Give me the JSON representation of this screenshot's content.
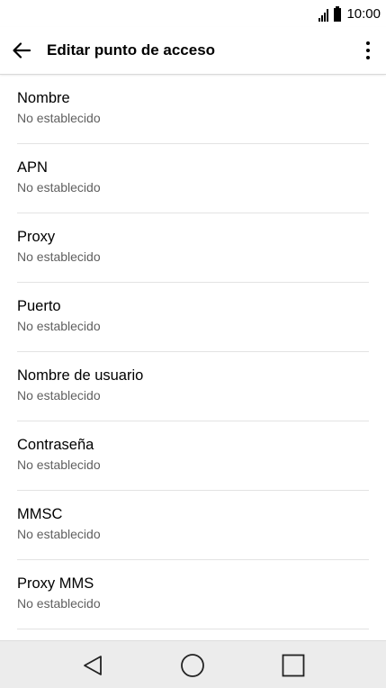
{
  "status_bar": {
    "time": "10:00",
    "icons": [
      "signal-icon",
      "battery-icon"
    ]
  },
  "app_bar": {
    "title": "Editar punto de acceso",
    "icons": [
      "back-arrow-icon",
      "more-vert-icon"
    ]
  },
  "settings": [
    {
      "label": "Nombre",
      "value": "No establecido"
    },
    {
      "label": "APN",
      "value": "No establecido"
    },
    {
      "label": "Proxy",
      "value": "No establecido"
    },
    {
      "label": "Puerto",
      "value": "No establecido"
    },
    {
      "label": "Nombre de usuario",
      "value": "No establecido"
    },
    {
      "label": "Contraseña",
      "value": "No establecido"
    },
    {
      "label": "MMSC",
      "value": "No establecido"
    },
    {
      "label": "Proxy MMS",
      "value": "No establecido"
    }
  ],
  "nav_bar": {
    "icons": [
      "back-triangle-icon",
      "home-circle-icon",
      "recents-square-icon"
    ]
  }
}
